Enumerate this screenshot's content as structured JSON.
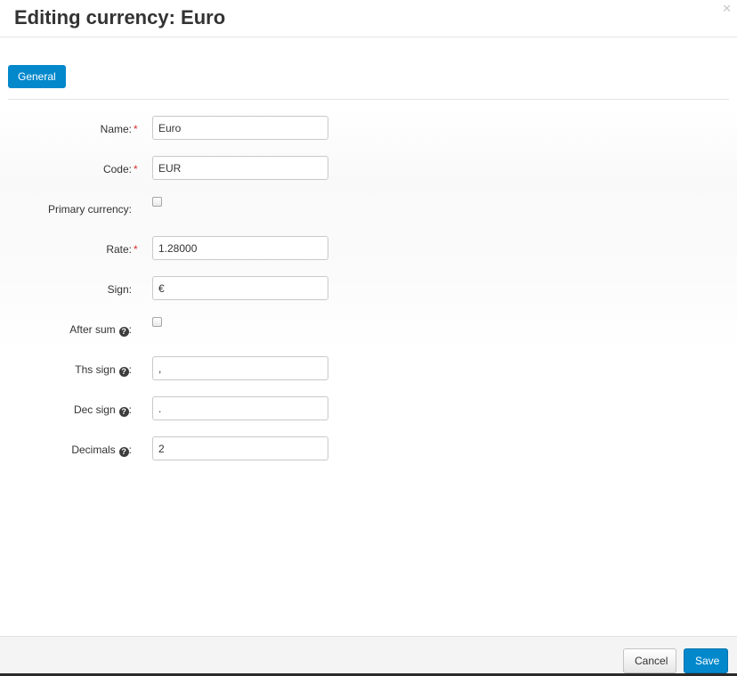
{
  "dialog": {
    "title": "Editing currency: Euro",
    "close_icon": "close-icon"
  },
  "tabs": [
    {
      "label": "General",
      "active": true
    }
  ],
  "form": {
    "name": {
      "label": "Name:",
      "required_mark": "*",
      "value": "Euro"
    },
    "code": {
      "label": "Code:",
      "required_mark": "*",
      "value": "EUR"
    },
    "primary_currency": {
      "label": "Primary currency:",
      "checked": false
    },
    "rate": {
      "label": "Rate:",
      "required_mark": "*",
      "value": "1.28000"
    },
    "sign": {
      "label": "Sign:",
      "value": "€"
    },
    "after_sum": {
      "label": "After sum",
      "colon": ":",
      "checked": false,
      "help_icon": "question-circle-icon"
    },
    "ths_sign": {
      "label": "Ths sign",
      "colon": ":",
      "value": ",",
      "help_icon": "question-circle-icon"
    },
    "dec_sign": {
      "label": "Dec sign",
      "colon": ":",
      "value": ".",
      "help_icon": "question-circle-icon"
    },
    "decimals": {
      "label": "Decimals",
      "colon": ":",
      "value": "2",
      "help_icon": "question-circle-icon"
    }
  },
  "footer": {
    "cancel_label": "Cancel",
    "save_label": "Save"
  },
  "colors": {
    "accent": "#0388cc",
    "required": "#d62f2f"
  }
}
